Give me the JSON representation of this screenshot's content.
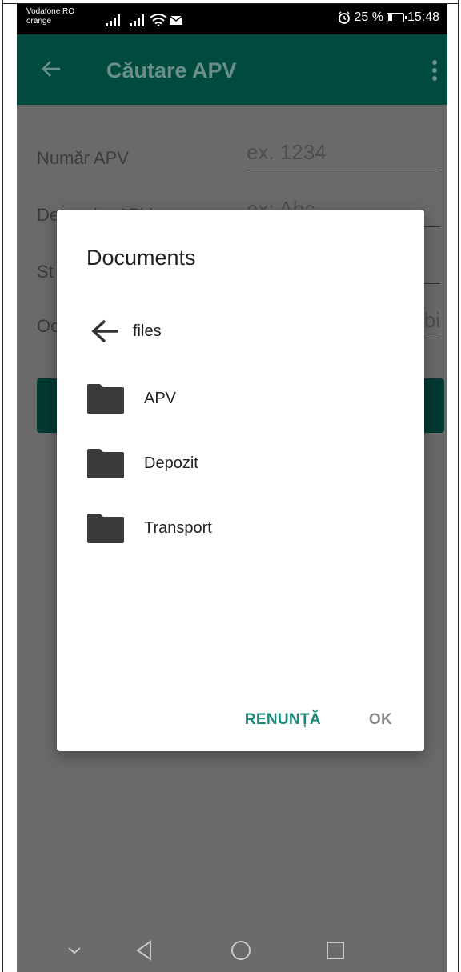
{
  "status_bar": {
    "carrier_line1": "Vodafone RO",
    "carrier_line2": "orange",
    "battery_percent": "25 %",
    "battery_level": 0.25,
    "time": "15:48"
  },
  "app_bar": {
    "title": "Căutare APV"
  },
  "form": {
    "fields": [
      {
        "label": "Număr APV",
        "placeholder": "ex. 1234"
      },
      {
        "label": "Denumire APV",
        "placeholder": "ex: Abc"
      },
      {
        "label": "St",
        "placeholder": ""
      },
      {
        "label": "Oc",
        "placeholder": "bi"
      }
    ]
  },
  "dialog": {
    "title": "Documents",
    "parent_folder": "files",
    "folders": [
      "APV",
      "Depozit",
      "Transport"
    ],
    "cancel_label": "RENUNȚĂ",
    "ok_label": "OK"
  },
  "colors": {
    "accent": "#1a8a7a",
    "app_bar_dimmed": "#014a40",
    "scrim": "#6a6a6a"
  }
}
